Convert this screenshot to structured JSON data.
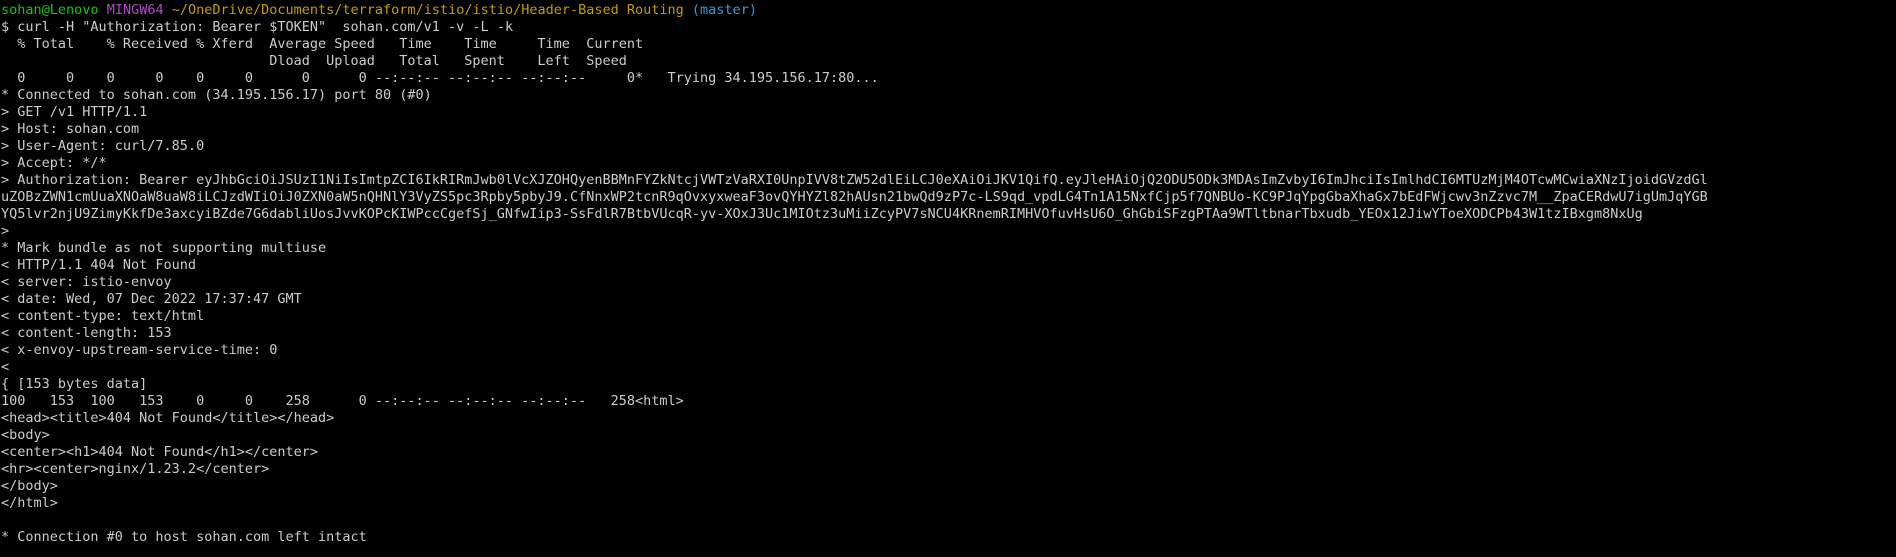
{
  "prompt": {
    "user_host": "sohan@Lenovo",
    "system": "MINGW64",
    "path": "~/OneDrive/Documents/terraform/istio/istio/Header-Based Routing",
    "branch": "(master)",
    "symbol": "$",
    "command": "curl -H \"Authorization: Bearer $TOKEN\"  sohan.com/v1 -v -L -k"
  },
  "colors": {
    "background": "#000000",
    "text": "#cccccc",
    "user_host": "#16c60c",
    "system": "#b148c6",
    "path": "#c19c00",
    "branch": "#3a96dd"
  },
  "output_lines": [
    "  % Total    % Received % Xferd  Average Speed   Time    Time     Time  Current",
    "                                 Dload  Upload   Total   Spent    Left  Speed",
    "  0     0    0     0    0     0      0      0 --:--:-- --:--:-- --:--:--     0*   Trying 34.195.156.17:80...",
    "* Connected to sohan.com (34.195.156.17) port 80 (#0)",
    "> GET /v1 HTTP/1.1",
    "> Host: sohan.com",
    "> User-Agent: curl/7.85.0",
    "> Accept: */*",
    "> Authorization: Bearer eyJhbGciOiJSUzI1NiIsImtpZCI6IkRIRmJwb0lVcXJZOHQyenBBMnFYZkNtcjVWTzVaRXI0UnpIVV8tZW52dlEiLCJ0eXAiOiJKV1QifQ.eyJleHAiOjQ2ODU5ODk3MDAsImZvbyI6ImJhciIsImlhdCI6MTUzMjM4OTcwMCwiaXNzIjoidGVzdGl",
    "uZOBzZWN1cmUuaXNOaW8uaW8iLCJzdWIiOiJ0ZXN0aW5nQHNlY3VyZS5pc3Rpby5pbyJ9.CfNnxWP2tcnR9qOvxyxweaF3ovQYHYZl82hAUsn21bwQd9zP7c-LS9qd_vpdLG4Tn1A15NxfCjp5f7QNBUo-KC9PJqYpgGbaXhaGx7bEdFWjcwv3nZzvc7M__ZpaCERdwU7igUmJqYGB",
    "YQ5lvr2njU9ZimyKkfDe3axcyiBZde7G6dabliUosJvvKOPcKIWPccCgefSj_GNfwIip3-SsFdlR7BtbVUcqR-yv-XOxJ3Uc1MIOtz3uMiiZcyPV7sNCU4KRnemRIMHVOfuvHsU6O_GhGbiSFzgPTAa9WTltbnarTbxudb_YEOx12JiwYToeXODCPb43W1tzIBxgm8NxUg",
    ">",
    "* Mark bundle as not supporting multiuse",
    "< HTTP/1.1 404 Not Found",
    "< server: istio-envoy",
    "< date: Wed, 07 Dec 2022 17:37:47 GMT",
    "< content-type: text/html",
    "< content-length: 153",
    "< x-envoy-upstream-service-time: 0",
    "<",
    "{ [153 bytes data]",
    "100   153  100   153    0     0    258      0 --:--:-- --:--:-- --:--:--   258<html>",
    "<head><title>404 Not Found</title></head>",
    "<body>",
    "<center><h1>404 Not Found</h1></center>",
    "<hr><center>nginx/1.23.2</center>",
    "</body>",
    "</html>",
    "",
    "* Connection #0 to host sohan.com left intact"
  ]
}
